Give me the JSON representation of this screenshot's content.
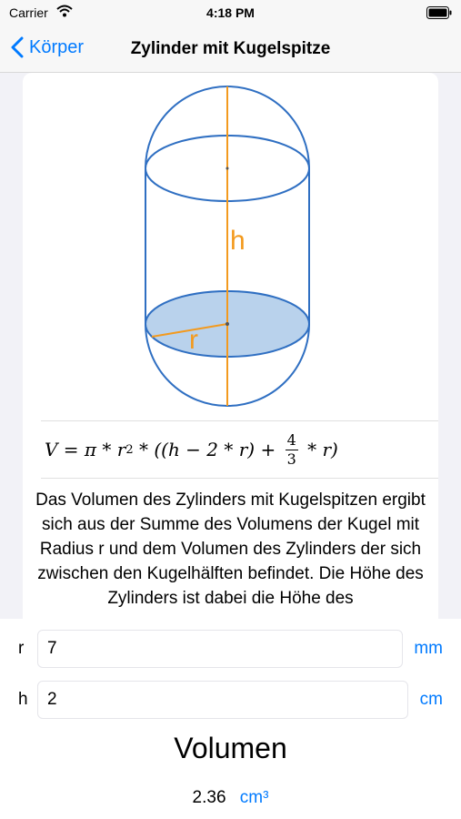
{
  "status_bar": {
    "carrier": "Carrier",
    "time": "4:18 PM"
  },
  "nav": {
    "back_label": "Körper",
    "title": "Zylinder mit Kugelspitze"
  },
  "figure": {
    "height_label": "h",
    "radius_label": "r"
  },
  "formula": {
    "lhs": "V = π * r",
    "exp": "2",
    "mid": " * ((h − 2 * r) + ",
    "frac_num": "4",
    "frac_den": "3",
    "rhs": " * r)"
  },
  "description": "Das Volumen des Zylinders mit Kugelspitzen ergibt sich aus der Summe des Volumens der Kugel mit Radius r und dem Volumen des Zylinders der sich zwischen den Kugelhälften befindet. Die Höhe des Zylinders ist dabei die Höhe des",
  "inputs": {
    "r": {
      "label": "r",
      "value": "7",
      "unit": "mm"
    },
    "h": {
      "label": "h",
      "value": "2",
      "unit": "cm"
    }
  },
  "result": {
    "title": "Volumen",
    "value": "2.36",
    "unit": "cm³"
  },
  "colors": {
    "accent": "#007aff",
    "shape": "#2f6fc2",
    "dimension": "#f39a1e",
    "base_fill": "#b9d2ec"
  }
}
